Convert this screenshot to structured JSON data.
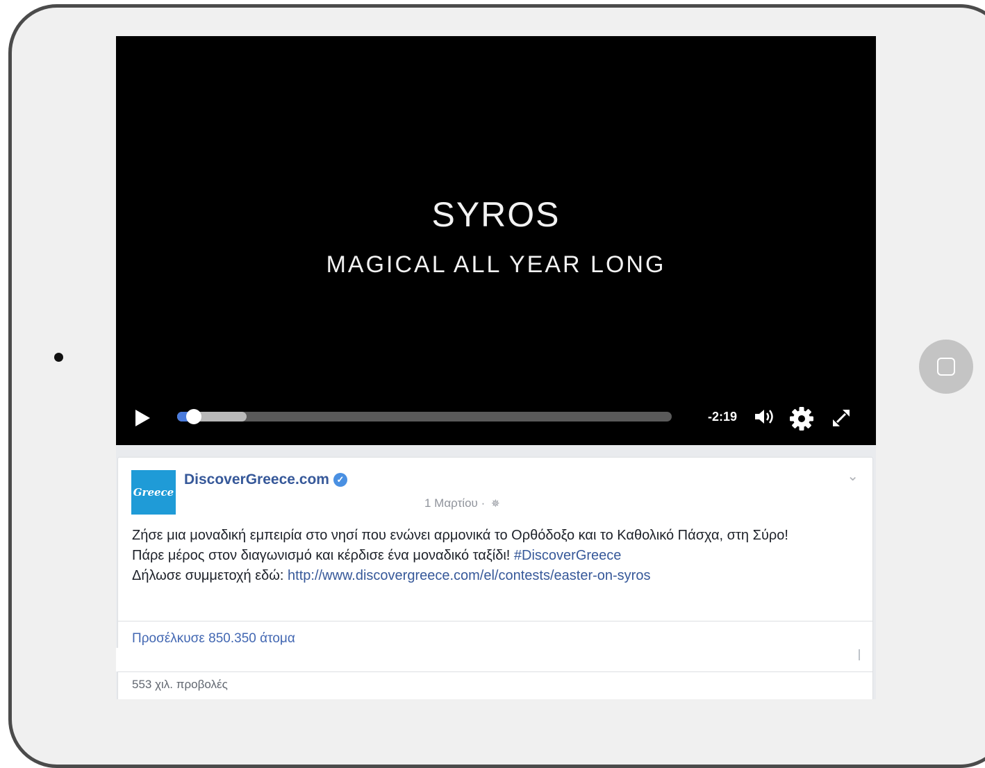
{
  "video": {
    "title": "SYROS",
    "subtitle": "MAGICAL ALL YEAR LONG",
    "time_remaining": "-2:19",
    "progress_fraction": 0.02,
    "buffered_fraction": 0.14
  },
  "post": {
    "page_name": "DiscoverGreece.com",
    "avatar_logo_text": "Greece",
    "date": "1 Μαρτίου",
    "separator": "·",
    "text": {
      "line1": "Ζήσε μια μοναδική εμπειρία στο νησί που ενώνει αρμονικά το Ορθόδοξο και το Καθολικό Πάσχα, στη Σύρο!",
      "line2": "Πάρε μέρος στον διαγωνισμό και κέρδισε ένα μοναδικό ταξίδι!",
      "hashtag": "#DiscoverGreece",
      "line3_prefix": "Δήλωσε συμμετοχή εδώ:",
      "link": "http://www.discovergreece.com/el/contests/easter-on-syros"
    },
    "reach": "Προσέλκυσε 850.350 άτομα",
    "views": "553 χιλ. προβολές"
  },
  "icons": [
    "play-icon",
    "volume-icon",
    "settings-gear-icon",
    "fullscreen-icon",
    "verified-badge-icon",
    "chevron-down-icon",
    "globe-icon",
    "home-button-icon"
  ],
  "colors": {
    "link": "#365899",
    "progress": "#4a7bdc",
    "avatar_bg": "#1f9bd7"
  }
}
